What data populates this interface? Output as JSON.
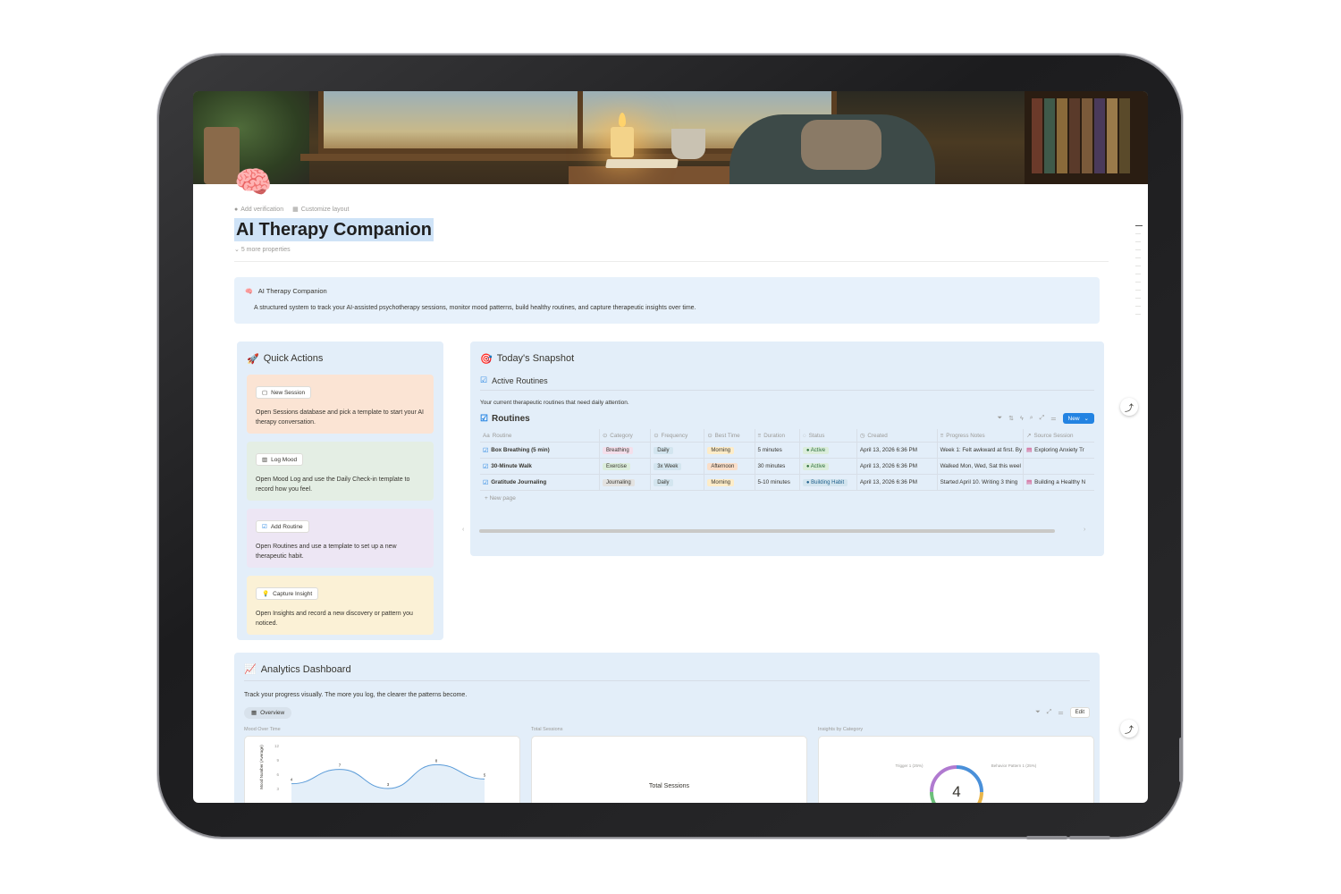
{
  "page": {
    "icon": "brain-icon",
    "title": "AI Therapy Companion",
    "add_verification": "Add verification",
    "customize_layout": "Customize layout",
    "more_properties": "5 more properties"
  },
  "callout": {
    "title": "AI Therapy Companion",
    "description": "A structured system to track your AI-assisted psychotherapy sessions, monitor mood patterns, build healthy routines, and capture therapeutic insights over time."
  },
  "quick_actions": {
    "heading": "Quick Actions",
    "cards": [
      {
        "button": "New Session",
        "description": "Open Sessions database and pick a template to start your AI therapy conversation.",
        "bg": "#fbe4d4"
      },
      {
        "button": "Log Mood",
        "description": "Open Mood Log and use the Daily Check-in template to record how you feel.",
        "bg": "#e4eee4"
      },
      {
        "button": "Add Routine",
        "description": "Open Routines and use a template to set up a new therapeutic habit.",
        "bg": "#ede6f4"
      },
      {
        "button": "Capture Insight",
        "description": "Open Insights and record a new discovery or pattern you noticed.",
        "bg": "#fbf1d6"
      }
    ]
  },
  "snapshot": {
    "heading": "Today's Snapshot",
    "sub_heading": "Active Routines",
    "description": "Your current therapeutic routines that need daily attention.",
    "db_title": "Routines",
    "new_button": "New",
    "columns": [
      "Routine",
      "Category",
      "Frequency",
      "Best Time",
      "Duration",
      "Status",
      "Created",
      "Progress Notes",
      "Source Session"
    ],
    "rows": [
      {
        "routine": "Box Breathing (5 min)",
        "category": "Breathing",
        "category_color": "#f4dfeb",
        "frequency": "Daily",
        "frequency_color": "#d3e5ef",
        "best_time": "Morning",
        "best_time_color": "#fdecc8",
        "duration": "5 minutes",
        "status": "Active",
        "status_color": "#dbeddb",
        "created": "April 13, 2026 6:36 PM",
        "notes": "Week 1: Felt awkward at first. By",
        "source": "Exploring Anxiety Tr"
      },
      {
        "routine": "30-Minute Walk",
        "category": "Exercise",
        "category_color": "#dbeddb",
        "frequency": "3x Week",
        "frequency_color": "#d3e5ef",
        "best_time": "Afternoon",
        "best_time_color": "#fadec9",
        "duration": "30 minutes",
        "status": "Active",
        "status_color": "#dbeddb",
        "created": "April 13, 2026 6:36 PM",
        "notes": "Walked Mon, Wed, Sat this weel",
        "source": ""
      },
      {
        "routine": "Gratitude Journaling",
        "category": "Journaling",
        "category_color": "#e3e2e0",
        "frequency": "Daily",
        "frequency_color": "#d3e5ef",
        "best_time": "Morning",
        "best_time_color": "#fdecc8",
        "duration": "5-10 minutes",
        "status": "Building Habit",
        "status_color": "#d3e5ef",
        "created": "April 13, 2026 6:36 PM",
        "notes": "Started April 10. Writing 3 thing",
        "source": "Building a Healthy N"
      }
    ],
    "new_page": "New page"
  },
  "analytics": {
    "heading": "Analytics Dashboard",
    "description": "Track your progress visually. The more you log, the clearer the patterns become.",
    "tab": "Overview",
    "edit": "Edit",
    "charts": {
      "mood_label": "Mood Over Time",
      "sessions_label": "Total Sessions",
      "insights_label": "Insights by Category",
      "sessions_caption": "Total Sessions",
      "donut_value": "4",
      "donut_left": "Trigger 1 (25%)",
      "donut_right": "Behavior Pattern 1 (25%)"
    }
  },
  "chart_data": {
    "type": "line",
    "title": "Mood Over Time",
    "xlabel": "",
    "ylabel": "Mood Number (Average)",
    "yticks": [
      12,
      9,
      6,
      3
    ],
    "ylim": [
      3,
      12
    ],
    "series": [
      {
        "values": [
          4,
          7,
          3,
          8,
          5
        ]
      }
    ],
    "data_labels": [
      "4",
      "7",
      "3",
      "8",
      "5"
    ]
  }
}
